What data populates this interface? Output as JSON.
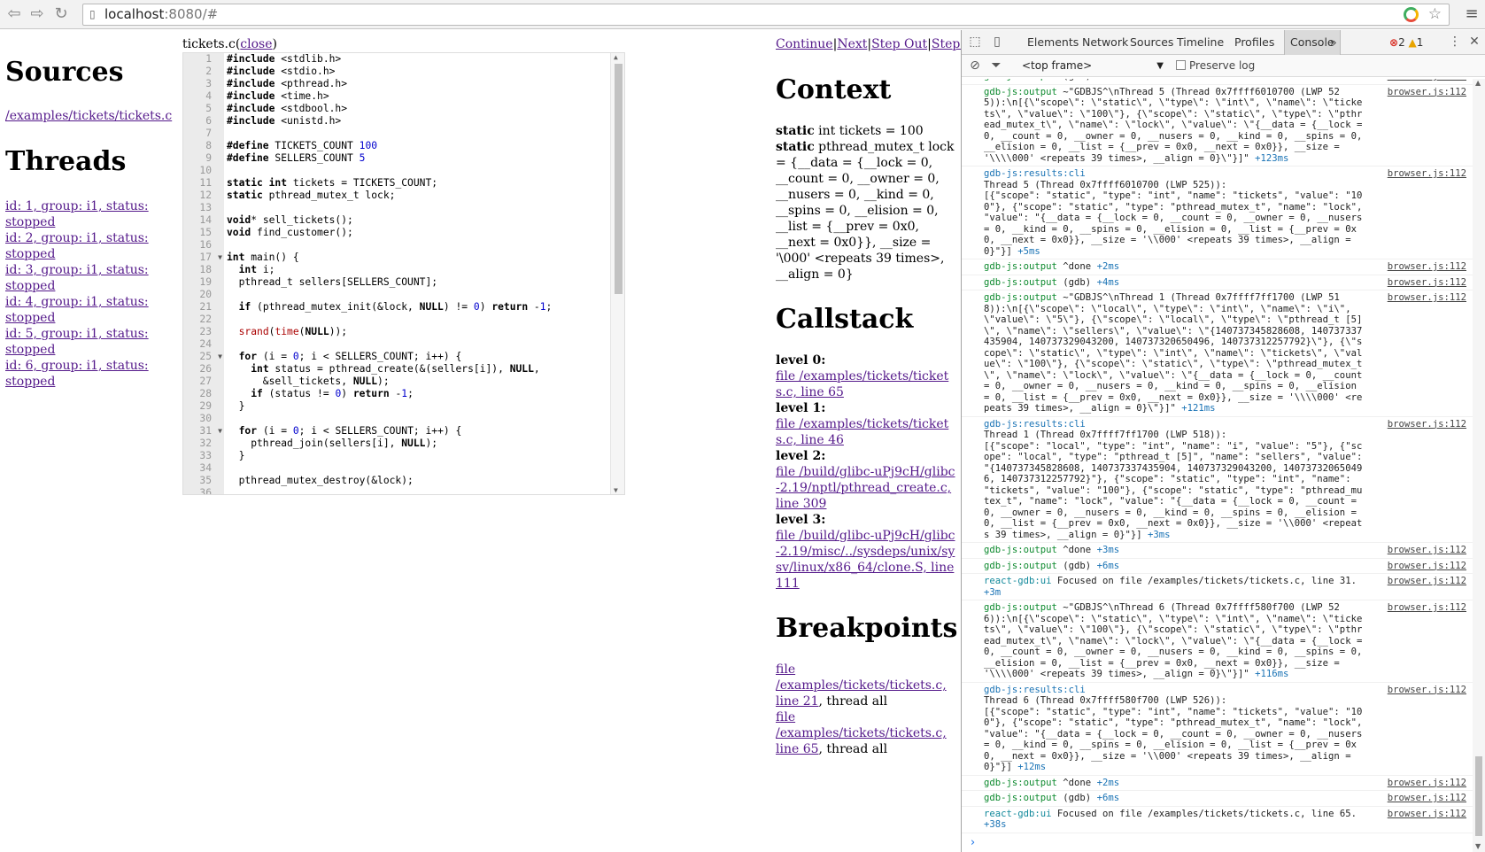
{
  "browser": {
    "url_host": "localhost",
    "url_rest": ":8080/#"
  },
  "sources": {
    "title": "Sources",
    "files": [
      "/examples/tickets/tickets.c"
    ]
  },
  "threads": {
    "title": "Threads",
    "items": [
      "id: 1, group: i1, status: stopped",
      "id: 2, group: i1, status: stopped",
      "id: 3, group: i1, status: stopped",
      "id: 4, group: i1, status: stopped",
      "id: 5, group: i1, status: stopped",
      "id: 6, group: i1, status: stopped"
    ]
  },
  "editor": {
    "filename": "tickets.c",
    "close_label": "close",
    "folds": [
      17,
      25,
      31
    ],
    "lines": [
      "#include <stdlib.h>",
      "#include <stdio.h>",
      "#include <pthread.h>",
      "#include <time.h>",
      "#include <stdbool.h>",
      "#include <unistd.h>",
      "",
      "#define TICKETS_COUNT 100",
      "#define SELLERS_COUNT 5",
      "",
      "static int tickets = TICKETS_COUNT;",
      "static pthread_mutex_t lock;",
      "",
      "void* sell_tickets();",
      "void find_customer();",
      "",
      "int main() {",
      "  int i;",
      "  pthread_t sellers[SELLERS_COUNT];",
      "",
      "  if (pthread_mutex_init(&lock, NULL) != 0) return -1;",
      "",
      "  srand(time(NULL));",
      "",
      "  for (i = 0; i < SELLERS_COUNT; i++) {",
      "    int status = pthread_create(&(sellers[i]), NULL,",
      "      &sell_tickets, NULL);",
      "    if (status != 0) return -1;",
      "  }",
      "",
      "  for (i = 0; i < SELLERS_COUNT; i++) {",
      "    pthread_join(sellers[i], NULL);",
      "  }",
      "",
      "  pthread_mutex_destroy(&lock);",
      ""
    ]
  },
  "controls": {
    "continue": "Continue",
    "next": "Next",
    "step_out": "Step Out",
    "step_in": "Step In"
  },
  "context": {
    "title": "Context",
    "vars": [
      {
        "qualifier": "static",
        "rest": " int tickets = 100"
      },
      {
        "qualifier": "static",
        "rest": " pthread_mutex_t lock = {__data = {__lock = 0, __count = 0, __owner = 0, __nusers = 0, __kind = 0, __spins = 0, __elision = 0, __list = {__prev = 0x0, __next = 0x0}}, __size = '\\000' <repeats 39 times>, __align = 0}"
      }
    ]
  },
  "callstack": {
    "title": "Callstack",
    "levels": [
      {
        "label": "level 0:",
        "link": "file /examples/tickets/tickets.c, line 65"
      },
      {
        "label": "level 1:",
        "link": "file /examples/tickets/tickets.c, line 46"
      },
      {
        "label": "level 2:",
        "link": "file /build/glibc-uPj9cH/glibc-2.19/nptl/pthread_create.c, line 309"
      },
      {
        "label": "level 3:",
        "link": "file /build/glibc-uPj9cH/glibc-2.19/misc/../sysdeps/unix/sysv/linux/x86_64/clone.S, line 111"
      }
    ]
  },
  "breakpoints": {
    "title": "Breakpoints",
    "items": [
      {
        "link": "file /examples/tickets/tickets.c, line 21",
        "suffix": ", thread all"
      },
      {
        "link": "file /examples/tickets/tickets.c, line 65",
        "suffix": ", thread all"
      }
    ]
  },
  "devtools": {
    "tabs": [
      "Elements",
      "Network",
      "Sources",
      "Timeline",
      "Profiles",
      "Console"
    ],
    "active_tab": "Console",
    "more": "»",
    "error_count": "2",
    "warning_count": "1",
    "frame": "<top frame>",
    "preserve_log": "Preserve log",
    "colors": {
      "gdb_tag": "#0d8a2e",
      "results_tag": "#1a73b5",
      "ui_tag": "#12899b"
    },
    "messages": [
      {
        "tag": "gdb-js:output",
        "kind": "out",
        "text": " (gdb) ",
        "delta": "+4ms",
        "src": "browser.js:112"
      },
      {
        "tag": "gdb-js:output",
        "kind": "out",
        "text": " ~\"GDBJS^\\nThread 5 (Thread 0x7ffff6010700 (LWP 525)):\\n[{\\\"scope\\\": \\\"static\\\", \\\"type\\\": \\\"int\\\", \\\"name\\\": \\\"tickets\\\", \\\"value\\\": \\\"100\\\"}, {\\\"scope\\\": \\\"static\\\", \\\"type\\\": \\\"pthread_mutex_t\\\", \\\"name\\\": \\\"lock\\\", \\\"value\\\": \\\"{__data = {__lock = 0, __count = 0, __owner = 0, __nusers = 0, __kind = 0, __spins = 0, __elision = 0, __list = {__prev = 0x0, __next = 0x0}}, __size = '\\\\\\\\000' <repeats 39 times>, __align = 0}\\\"}]\" ",
        "delta": "+123ms",
        "src": "browser.js:112"
      },
      {
        "tag": "gdb-js:results:cli",
        "kind": "res",
        "text": "\nThread 5 (Thread 0x7ffff6010700 (LWP 525)):\n[{\"scope\": \"static\", \"type\": \"int\", \"name\": \"tickets\", \"value\": \"100\"}, {\"scope\": \"static\", \"type\": \"pthread_mutex_t\", \"name\": \"lock\", \"value\": \"{__data = {__lock = 0, __count = 0, __owner = 0, __nusers = 0, __kind = 0, __spins = 0, __elision = 0, __list = {__prev = 0x0, __next = 0x0}}, __size = '\\\\000' <repeats 39 times>, __align = 0}\"}] ",
        "delta": "+5ms",
        "src": "browser.js:112"
      },
      {
        "tag": "gdb-js:output",
        "kind": "out",
        "text": " ^done ",
        "delta": "+2ms",
        "src": "browser.js:112"
      },
      {
        "tag": "gdb-js:output",
        "kind": "out",
        "text": " (gdb) ",
        "delta": "+4ms",
        "src": "browser.js:112"
      },
      {
        "tag": "gdb-js:output",
        "kind": "out",
        "text": " ~\"GDBJS^\\nThread 1 (Thread 0x7ffff7ff1700 (LWP 518)):\\n[{\\\"scope\\\": \\\"local\\\", \\\"type\\\": \\\"int\\\", \\\"name\\\": \\\"i\\\", \\\"value\\\": \\\"5\\\"}, {\\\"scope\\\": \\\"local\\\", \\\"type\\\": \\\"pthread_t [5]\\\", \\\"name\\\": \\\"sellers\\\", \\\"value\\\": \\\"{140737345828608, 140737337435904, 140737329043200, 140737320650496, 140737312257792}\\\"}, {\\\"scope\\\": \\\"static\\\", \\\"type\\\": \\\"int\\\", \\\"name\\\": \\\"tickets\\\", \\\"value\\\": \\\"100\\\"}, {\\\"scope\\\": \\\"static\\\", \\\"type\\\": \\\"pthread_mutex_t\\\", \\\"name\\\": \\\"lock\\\", \\\"value\\\": \\\"{__data = {__lock = 0, __count = 0, __owner = 0, __nusers = 0, __kind = 0, __spins = 0, __elision = 0, __list = {__prev = 0x0, __next = 0x0}}, __size = '\\\\\\\\000' <repeats 39 times>, __align = 0}\\\"}]\" ",
        "delta": "+121ms",
        "src": "browser.js:112"
      },
      {
        "tag": "gdb-js:results:cli",
        "kind": "res",
        "text": "\nThread 1 (Thread 0x7ffff7ff1700 (LWP 518)):\n[{\"scope\": \"local\", \"type\": \"int\", \"name\": \"i\", \"value\": \"5\"}, {\"scope\": \"local\", \"type\": \"pthread_t [5]\", \"name\": \"sellers\", \"value\": \"{140737345828608, 140737337435904, 140737329043200, 140737320650496, 140737312257792}\"}, {\"scope\": \"static\", \"type\": \"int\", \"name\": \"tickets\", \"value\": \"100\"}, {\"scope\": \"static\", \"type\": \"pthread_mutex_t\", \"name\": \"lock\", \"value\": \"{__data = {__lock = 0, __count = 0, __owner = 0, __nusers = 0, __kind = 0, __spins = 0, __elision = 0, __list = {__prev = 0x0, __next = 0x0}}, __size = '\\\\000' <repeats 39 times>, __align = 0}\"}] ",
        "delta": "+3ms",
        "src": "browser.js:112"
      },
      {
        "tag": "gdb-js:output",
        "kind": "out",
        "text": " ^done ",
        "delta": "+3ms",
        "src": "browser.js:112"
      },
      {
        "tag": "gdb-js:output",
        "kind": "out",
        "text": " (gdb) ",
        "delta": "+6ms",
        "src": "browser.js:112"
      },
      {
        "tag": "react-gdb:ui",
        "kind": "ui",
        "text": " Focused on file /examples/tickets/tickets.c, line 31. ",
        "delta": "+3m",
        "src": "browser.js:112"
      },
      {
        "tag": "gdb-js:output",
        "kind": "out",
        "text": " ~\"GDBJS^\\nThread 6 (Thread 0x7ffff580f700 (LWP 526)):\\n[{\\\"scope\\\": \\\"static\\\", \\\"type\\\": \\\"int\\\", \\\"name\\\": \\\"tickets\\\", \\\"value\\\": \\\"100\\\"}, {\\\"scope\\\": \\\"static\\\", \\\"type\\\": \\\"pthread_mutex_t\\\", \\\"name\\\": \\\"lock\\\", \\\"value\\\": \\\"{__data = {__lock = 0, __count = 0, __owner = 0, __nusers = 0, __kind = 0, __spins = 0, __elision = 0, __list = {__prev = 0x0, __next = 0x0}}, __size = '\\\\\\\\000' <repeats 39 times>, __align = 0}\\\"}]\" ",
        "delta": "+116ms",
        "src": "browser.js:112"
      },
      {
        "tag": "gdb-js:results:cli",
        "kind": "res",
        "text": "\nThread 6 (Thread 0x7ffff580f700 (LWP 526)):\n[{\"scope\": \"static\", \"type\": \"int\", \"name\": \"tickets\", \"value\": \"100\"}, {\"scope\": \"static\", \"type\": \"pthread_mutex_t\", \"name\": \"lock\", \"value\": \"{__data = {__lock = 0, __count = 0, __owner = 0, __nusers = 0, __kind = 0, __spins = 0, __elision = 0, __list = {__prev = 0x0, __next = 0x0}}, __size = '\\\\000' <repeats 39 times>, __align = 0}\"}] ",
        "delta": "+12ms",
        "src": "browser.js:112"
      },
      {
        "tag": "gdb-js:output",
        "kind": "out",
        "text": " ^done ",
        "delta": "+2ms",
        "src": "browser.js:112"
      },
      {
        "tag": "gdb-js:output",
        "kind": "out",
        "text": " (gdb) ",
        "delta": "+6ms",
        "src": "browser.js:112"
      },
      {
        "tag": "react-gdb:ui",
        "kind": "ui",
        "text": " Focused on file /examples/tickets/tickets.c, line 65. ",
        "delta": "+38s",
        "src": "browser.js:112"
      }
    ]
  }
}
